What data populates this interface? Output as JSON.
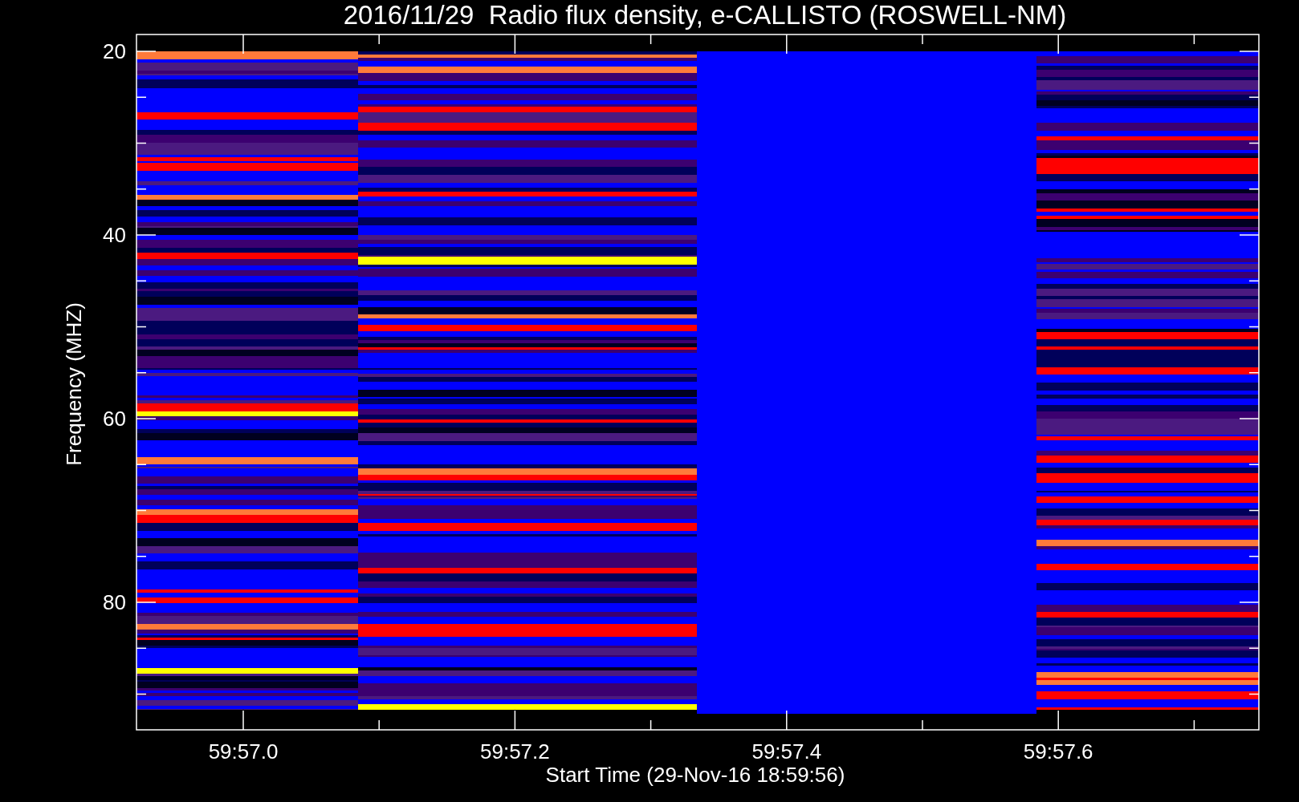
{
  "title": "2016/11/29  Radio flux density, e-CALLISTO (ROSWELL-NM)",
  "y_axis": {
    "label": "Frequency (MHZ)",
    "ticks": [
      "20",
      "40",
      "60",
      "80"
    ]
  },
  "x_axis": {
    "label": "Start Time (29-Nov-16 18:59:56)",
    "ticks": [
      "59:57.0",
      "59:57.2",
      "59:57.4",
      "59:57.6"
    ]
  }
}
